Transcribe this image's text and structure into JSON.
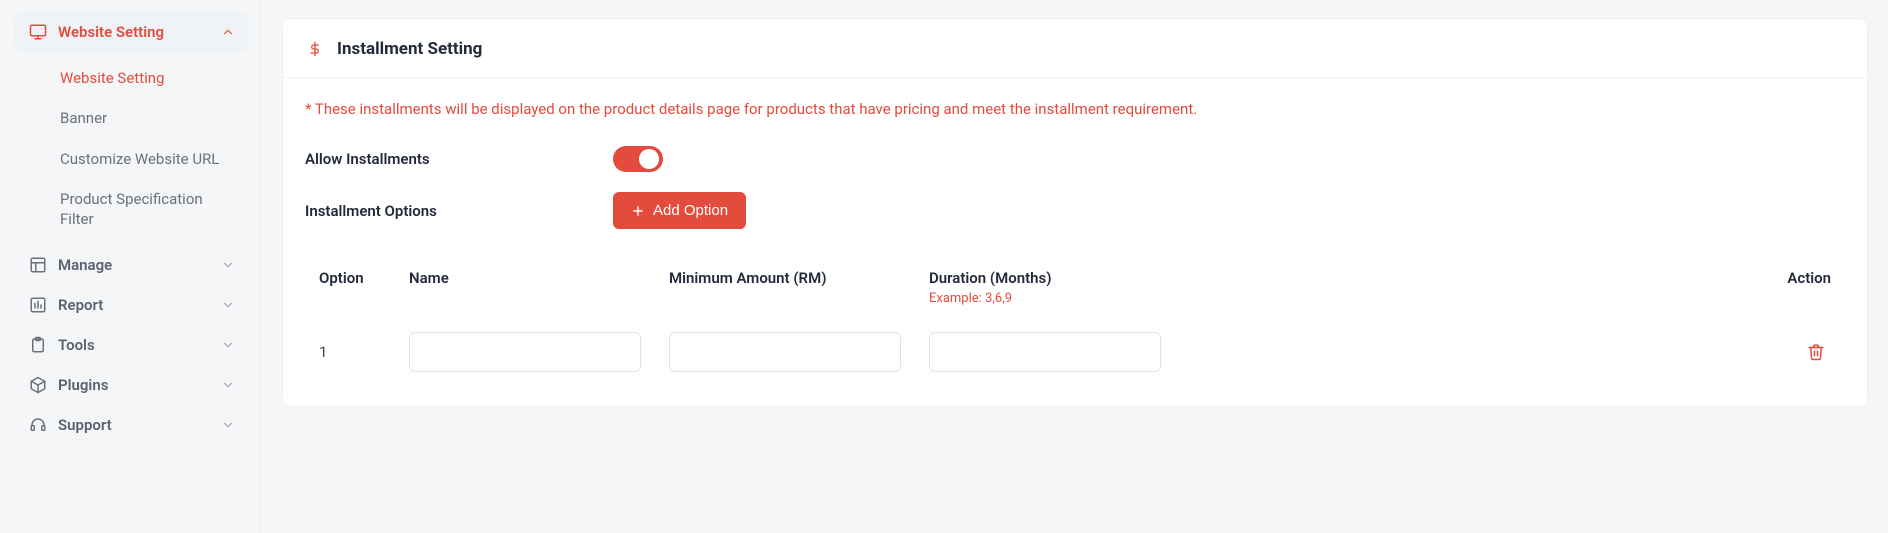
{
  "colors": {
    "accent": "#e34b3d"
  },
  "sidebar": {
    "items": [
      {
        "label": "Website Setting",
        "icon": "monitor-icon",
        "expanded": true,
        "active": true,
        "children": [
          {
            "label": "Website Setting",
            "active": true
          },
          {
            "label": "Banner",
            "active": false
          },
          {
            "label": "Customize Website URL",
            "active": false
          },
          {
            "label": "Product Specification Filter",
            "active": false
          }
        ]
      },
      {
        "label": "Manage",
        "icon": "layout-icon",
        "expanded": false
      },
      {
        "label": "Report",
        "icon": "bar-chart-icon",
        "expanded": false
      },
      {
        "label": "Tools",
        "icon": "clipboard-icon",
        "expanded": false
      },
      {
        "label": "Plugins",
        "icon": "package-icon",
        "expanded": false
      },
      {
        "label": "Support",
        "icon": "headset-icon",
        "expanded": false
      }
    ]
  },
  "page": {
    "title": "Installment Setting",
    "note": "* These installments will be displayed on the product details page for products that have pricing and meet the installment requirement.",
    "allow_label": "Allow Installments",
    "allow_value": true,
    "options_label": "Installment Options",
    "add_option_label": "Add Option"
  },
  "table": {
    "headers": {
      "option": "Option",
      "name": "Name",
      "min_amount": "Minimum Amount (RM)",
      "duration": "Duration (Months)",
      "duration_example": "Example: 3,6,9",
      "action": "Action"
    },
    "rows": [
      {
        "option": "1",
        "name": "",
        "min_amount": "",
        "duration": ""
      }
    ]
  }
}
